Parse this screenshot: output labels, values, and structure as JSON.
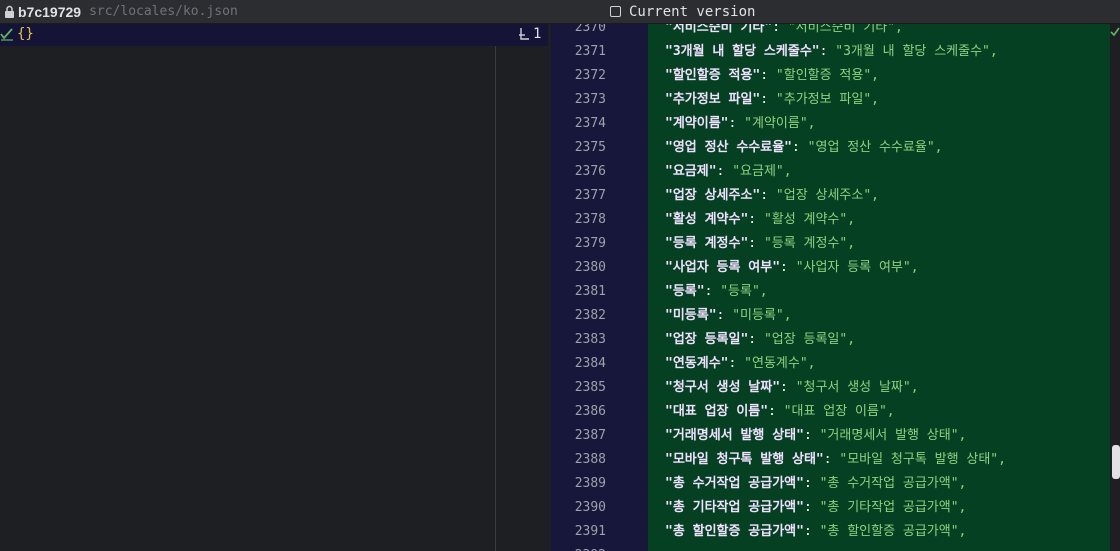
{
  "tab": {
    "commit": "b7c19729",
    "path": "src/locales/ko.json",
    "version_label": "Current version"
  },
  "left_panel": {
    "braces": "{}",
    "problem_count": "1"
  },
  "colors": {
    "added_background": "#064023",
    "gutter_background": "#16173a",
    "key": "#f0e1ff",
    "string_value": "#8fd27f",
    "braces": "#e2c04f"
  },
  "icons": {
    "header": [
      "lock-icon",
      "checkbox-icon"
    ],
    "left": [
      "checkmark-icon",
      "problems-icon"
    ],
    "right": [
      "tick-icon"
    ]
  },
  "lines": [
    {
      "num": "2370",
      "key": "\"서비스순비 기타\"",
      "value": "\"서비스순비 기타\","
    },
    {
      "num": "2371",
      "key": "\"3개월 내 할당 스케줄수\"",
      "value": "\"3개월 내 할당 스케줄수\","
    },
    {
      "num": "2372",
      "key": "\"할인할증 적용\"",
      "value": "\"할인할증 적용\","
    },
    {
      "num": "2373",
      "key": "\"추가정보 파일\"",
      "value": "\"추가정보 파일\","
    },
    {
      "num": "2374",
      "key": "\"계약이름\"",
      "value": "\"계약이름\","
    },
    {
      "num": "2375",
      "key": "\"영업 정산 수수료율\"",
      "value": "\"영업 정산 수수료율\","
    },
    {
      "num": "2376",
      "key": "\"요금제\"",
      "value": "\"요금제\","
    },
    {
      "num": "2377",
      "key": "\"업장 상세주소\"",
      "value": "\"업장 상세주소\","
    },
    {
      "num": "2378",
      "key": "\"활성 계약수\"",
      "value": "\"활성 계약수\","
    },
    {
      "num": "2379",
      "key": "\"등록 계정수\"",
      "value": "\"등록 계정수\","
    },
    {
      "num": "2380",
      "key": "\"사업자 등록 여부\"",
      "value": "\"사업자 등록 여부\","
    },
    {
      "num": "2381",
      "key": "\"등록\"",
      "value": "\"등록\","
    },
    {
      "num": "2382",
      "key": "\"미등록\"",
      "value": "\"미등록\","
    },
    {
      "num": "2383",
      "key": "\"업장 등록일\"",
      "value": "\"업장 등록일\","
    },
    {
      "num": "2384",
      "key": "\"연동계수\"",
      "value": "\"연동계수\","
    },
    {
      "num": "2385",
      "key": "\"청구서 생성 날짜\"",
      "value": "\"청구서 생성 날짜\","
    },
    {
      "num": "2386",
      "key": "\"대표 업장 이름\"",
      "value": "\"대표 업장 이름\","
    },
    {
      "num": "2387",
      "key": "\"거래명세서 발행 상태\"",
      "value": "\"거래명세서 발행 상태\","
    },
    {
      "num": "2388",
      "key": "\"모바일 청구톡 발행 상태\"",
      "value": "\"모바일 청구톡 발행 상태\","
    },
    {
      "num": "2389",
      "key": "\"총 수거작업 공급가액\"",
      "value": "\"총 수거작업 공급가액\","
    },
    {
      "num": "2390",
      "key": "\"총 기타작업 공급가액\"",
      "value": "\"총 기타작업 공급가액\","
    },
    {
      "num": "2391",
      "key": "\"총 할인할증 공급가액\"",
      "value": "\"총 할인할증 공급가액\","
    },
    {
      "num": "2392",
      "key": "",
      "value": ""
    }
  ]
}
